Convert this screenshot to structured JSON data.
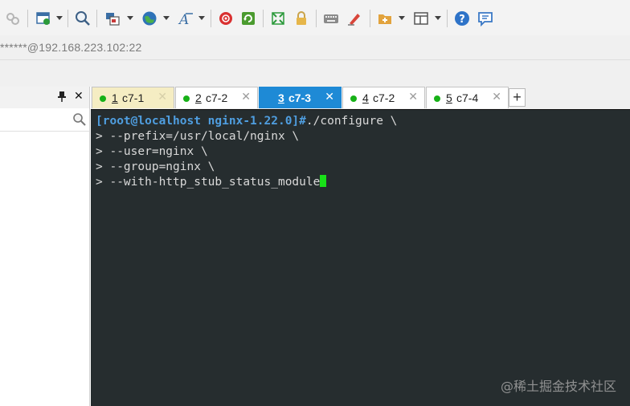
{
  "toolbar": {
    "icons": [
      "link-icon",
      "new-window-icon",
      "search-icon",
      "layout-icon",
      "globe-icon",
      "font-icon",
      "record-icon",
      "transfer-icon",
      "fullscreen-icon",
      "lock-icon",
      "keyboard-icon",
      "highlight-icon",
      "new-folder-icon",
      "window-layout-icon",
      "help-icon",
      "chat-icon"
    ]
  },
  "address": {
    "text": "******@192.168.223.102:22"
  },
  "panel": {
    "pin_glyph": "📌",
    "close_glyph": "✕"
  },
  "tabs": [
    {
      "num": "1",
      "label": "c7-1",
      "state": "first"
    },
    {
      "num": "2",
      "label": "c7-2",
      "state": "normal"
    },
    {
      "num": "3",
      "label": "c7-3",
      "state": "active"
    },
    {
      "num": "4",
      "label": "c7-2",
      "state": "normal"
    },
    {
      "num": "5",
      "label": "c7-4",
      "state": "normal"
    }
  ],
  "tab_add_label": "+",
  "terminal": {
    "prompt": "[root@localhost nginx-1.22.0]#",
    "command": "./configure \\",
    "continuations": [
      "> --prefix=/usr/local/nginx \\",
      "> --user=nginx \\",
      "> --group=nginx \\",
      "> --with-http_stub_status_module"
    ]
  },
  "watermark": "@稀土掘金技术社区",
  "colors": {
    "active_tab": "#1e8ad6",
    "first_tab": "#f5edc3",
    "status_dot": "#17b117",
    "terminal_bg": "#262d2f",
    "prompt": "#4f9ee0",
    "cursor": "#18e018"
  }
}
